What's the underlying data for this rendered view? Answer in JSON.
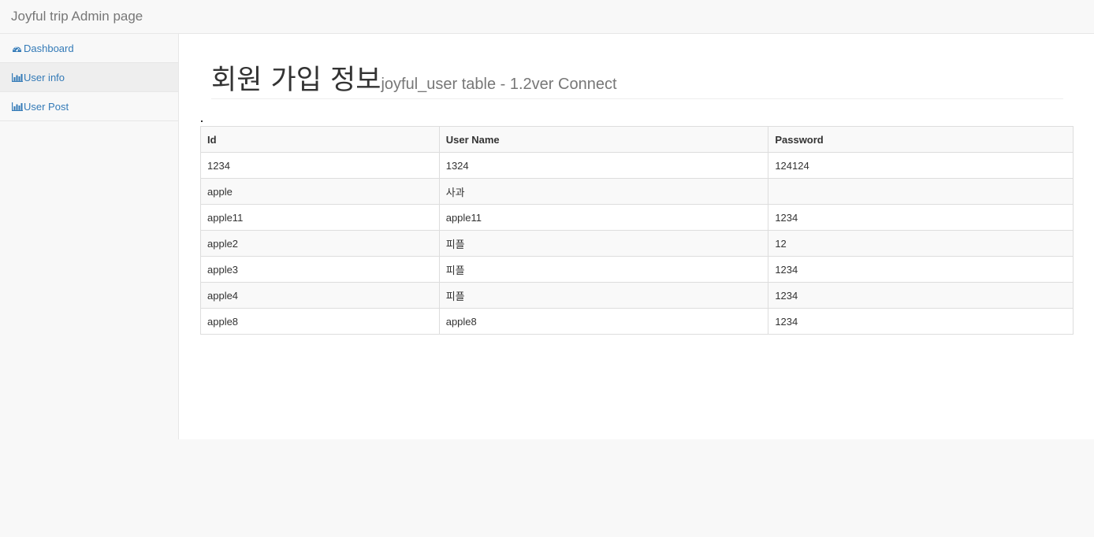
{
  "navbar": {
    "brand": "Joyful trip Admin page"
  },
  "sidebar": {
    "items": [
      {
        "label": "Dashboard",
        "icon": "dashboard-icon",
        "active": false
      },
      {
        "label": "User info",
        "icon": "bar-chart-icon",
        "active": true
      },
      {
        "label": "User Post",
        "icon": "bar-chart-icon",
        "active": false
      }
    ]
  },
  "main": {
    "title": "회원 가입 정보",
    "subtitle": "joyful_user table - 1.2ver Connect"
  },
  "table": {
    "headers": [
      "Id",
      "User Name",
      "Password"
    ],
    "rows": [
      [
        "1234",
        "1324",
        "124124"
      ],
      [
        "apple",
        "사과",
        ""
      ],
      [
        "apple11",
        "apple11",
        "1234"
      ],
      [
        "apple2",
        "피플",
        "12"
      ],
      [
        "apple3",
        "피플",
        "1234"
      ],
      [
        "apple4",
        "피플",
        "1234"
      ],
      [
        "apple8",
        "apple8",
        "1234"
      ]
    ]
  },
  "colors": {
    "link": "#337ab7",
    "border": "#dddddd",
    "stripe": "#f9f9f9",
    "navbar_bg": "#f8f8f8"
  }
}
